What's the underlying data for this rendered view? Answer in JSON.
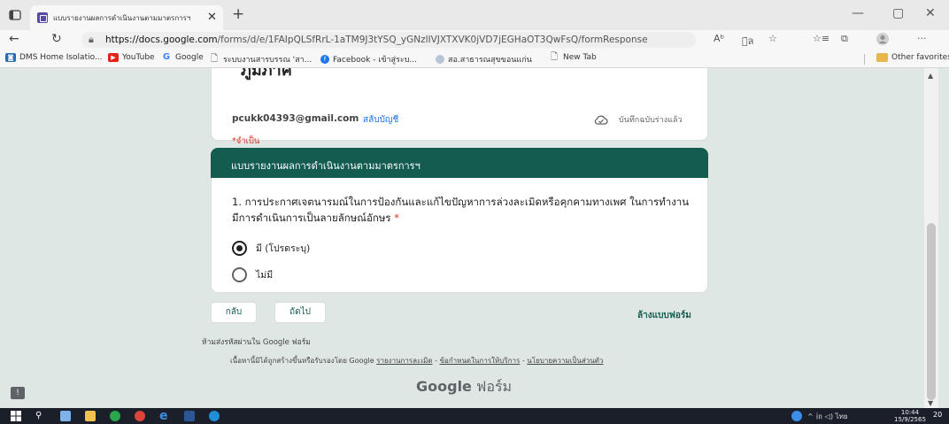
{
  "browser": {
    "tab_title": "แบบรายงานผลการดำเนินงานตามมาตรการฯ",
    "tab_close": "✕",
    "new_tab": "+",
    "url_domain": "https://docs.google.com",
    "url_path": "/forms/d/e/1FAIpQLSfRrL-1aTM9J3tYSQ_yGNzlIVJXTXVK0jVD7jEGHaOT3QwFsQ/formResponse",
    "read_aloud": "Aᵇ",
    "translate": "อ̈ล",
    "more": "···",
    "minimize": "—",
    "maximize": "▢",
    "close": "✕"
  },
  "bookmarks": [
    {
      "label": "DMS Home Isolatio...",
      "icon": "dms-icon",
      "color": "#2b6cb0"
    },
    {
      "label": "YouTube",
      "icon": "youtube-icon",
      "color": "#e62117"
    },
    {
      "label": "Google",
      "icon": "google-icon",
      "color": "#4285f4"
    },
    {
      "label": "ระบบงานสารบรรณ 'สา...",
      "icon": "page-icon",
      "color": "#666666"
    },
    {
      "label": "Facebook - เข้าสู่ระบ...",
      "icon": "facebook-icon",
      "color": "#1877f2"
    },
    {
      "label": "สอ.สาธารณสุขขอนแก่น",
      "icon": "site-icon",
      "color": "#8a8a8a"
    },
    {
      "label": "New Tab",
      "icon": "page-icon",
      "color": "#666666"
    }
  ],
  "other_favorites": "Other favorites",
  "form": {
    "partial_title": "ภูมิภาค",
    "email": "pcukk04393@gmail.com",
    "switch_account": "สลับบัญชี",
    "draft_saved": "บันทึกฉบับร่างแล้ว",
    "required_note": "*จำเป็น",
    "section_title": "แบบรายงานผลการดำเนินงานตามมาตรการฯ",
    "question": "1. การประกาศเจตนารมณ์ในการป้องกันและแก้ไขปัญหาการล่วงละเมิดหรือคุกคามทางเพศ ในการทำงาน มีการดำเนินการเป็นลายลักษณ์อักษร",
    "question_star": "*",
    "options": [
      {
        "label": "มี (โปรดระบุ)",
        "selected": true
      },
      {
        "label": "ไม่มี",
        "selected": false
      }
    ],
    "back_button": "กลับ",
    "next_button": "ถัดไป",
    "clear_form": "ล้างแบบฟอร์ม",
    "no_password": "ห้ามส่งรหัสผ่านใน Google ฟอร์ม",
    "footer_prefix": "เนื้อหานี้มิได้ถูกสร้างขึ้นหรือรับรองโดย Google",
    "footer_report": "รายงานการละเมิด",
    "footer_sep1": " - ",
    "footer_terms": "ข้อกำหนดในการให้บริการ",
    "footer_sep2": " - ",
    "footer_privacy": "นโยบายความเป็นส่วนตัว",
    "brand_google": "Google",
    "brand_forms": "ฟอร์ม"
  },
  "taskbar": {
    "tray_text": "^ ㏌ ◁) ไทย",
    "time": "10:44",
    "date": "15/9/2565",
    "notif": "20"
  },
  "colors": {
    "theme": "#135c4f",
    "background": "#dfe7e4",
    "link": "#1a73e8",
    "required": "#d93025"
  }
}
